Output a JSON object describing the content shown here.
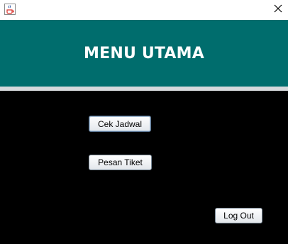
{
  "window": {
    "app_icon": "java-cup-icon",
    "close_icon": "close-icon"
  },
  "header": {
    "title": "MENU UTAMA"
  },
  "menu": {
    "cek_jadwal_label": "Cek Jadwal",
    "pesan_tiket_label": "Pesan Tiket",
    "log_out_label": "Log Out"
  },
  "colors": {
    "header_bg": "#006d6d",
    "content_bg": "#000000",
    "separator": "#d6d9dc"
  }
}
